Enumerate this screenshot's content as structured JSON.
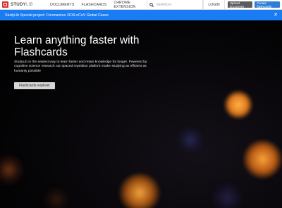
{
  "navbar": {
    "logo_main": "STUDY",
    "logo_lite": "LIB",
    "links": [
      "DOCUMENTS",
      "FLASHCARDS",
      "CHROME EXTENSION"
    ],
    "search_placeholder": "SEARCH",
    "login_label": "LOGIN",
    "upload_label": "Upload document",
    "create_label": "Create flashcards"
  },
  "banner": {
    "text": "StudyLib Special project: Coronavirus 2019-nCoV Global Cases",
    "close_icon": "close-icon"
  },
  "hero": {
    "title": "Learn anything faster with Flashcards",
    "description": "StudyLib is the easiest way to learn faster and retain knowledge for longer. Powered by cognitive science research our spaced repetition platform make studying as efficient as humanly possible",
    "button_label": "Flashcards explorer"
  },
  "colors": {
    "banner_bg": "#1a7cf3",
    "create_button_bg": "#2b7fd6",
    "upload_button_bg": "#5b5b5b",
    "logo_red": "#d9302c"
  }
}
